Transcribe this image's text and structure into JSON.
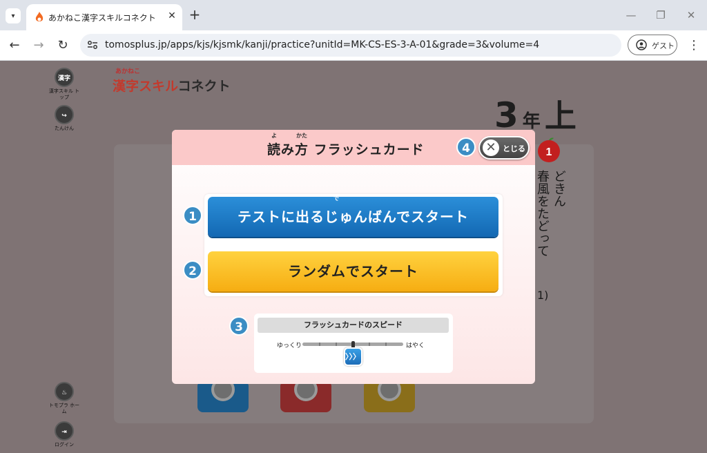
{
  "browser": {
    "tab_title": "あかねこ漢字スキルコネクト 光村図",
    "tab_close": "✕",
    "new_tab": "+",
    "url": "tomosplus.jp/apps/kjs/kjsmk/kanji/practice?unitId=MK-CS-ES-3-A-01&grade=3&volume=4",
    "profile_label": "ゲスト"
  },
  "sidebar": {
    "kanji_top": {
      "icon_text": "漢字",
      "label": "漢字スキル トップ"
    },
    "tanken": {
      "label": "たんけん"
    },
    "tomopla_home": {
      "label": "トモプラ ホーム"
    },
    "login": {
      "label": "ログイン"
    }
  },
  "logo": {
    "small": "あかねこ",
    "main": "漢字スキル",
    "sub": "コネクト"
  },
  "grade": {
    "number": "3",
    "nen": "年",
    "volume": "上"
  },
  "background_card": {
    "number": "1",
    "line1": "どきん",
    "line2": "春風をたどって",
    "suffix": "1)"
  },
  "modal": {
    "title_part1": "読み方",
    "title_part2": " フラッシュカード",
    "ruby_yo": "よ",
    "ruby_kata": "かた",
    "close_label": "とじる",
    "badges": [
      "1",
      "2",
      "3",
      "4"
    ],
    "start_in_order": "テストに出るじゅんばんでスタート",
    "ruby_de": "で",
    "start_random": "ランダムでスタート",
    "speed": {
      "title": "フラッシュカードのスピード",
      "slow": "ゆっくり",
      "fast": "はやく",
      "level_fraction": 0.5
    }
  },
  "colors": {
    "overlay": "#7f7374",
    "modal_header": "#fbc9c9",
    "blue_button": "#1f7fcc",
    "yellow_button": "#fbbd24",
    "badge": "#3b8dc4"
  }
}
